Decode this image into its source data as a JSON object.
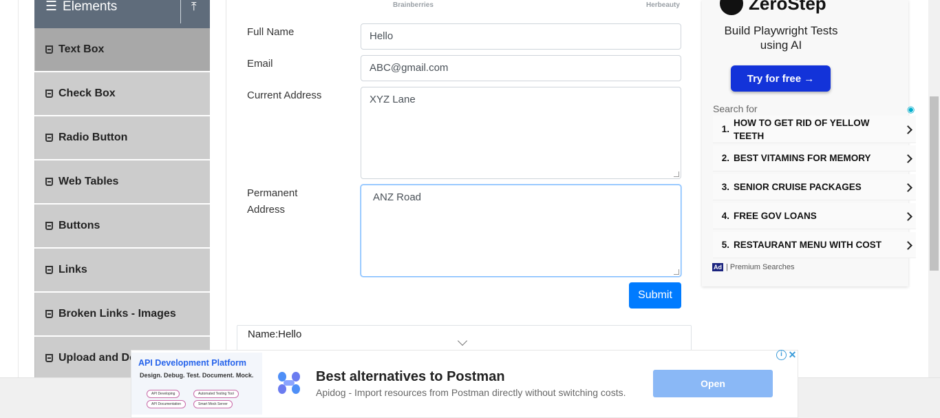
{
  "sidebar": {
    "header": {
      "title": "Elements",
      "collapse_icon": "upload-arrow-icon"
    },
    "items": [
      {
        "label": "Text Box",
        "active": true
      },
      {
        "label": "Check Box"
      },
      {
        "label": "Radio Button"
      },
      {
        "label": "Web Tables"
      },
      {
        "label": "Buttons"
      },
      {
        "label": "Links"
      },
      {
        "label": "Broken Links - Images"
      },
      {
        "label": "Upload and Download"
      }
    ]
  },
  "top_logos": [
    "Brainberries",
    "Herbeauty"
  ],
  "form": {
    "full_name": {
      "label": "Full Name",
      "value": "Hello"
    },
    "email": {
      "label": "Email",
      "value": "ABC@gmail.com"
    },
    "current_address": {
      "label": "Current Address",
      "value": "XYZ Lane"
    },
    "permanent_address": {
      "label": "Permanent Address",
      "value": "ANZ Road"
    },
    "submit_label": "Submit"
  },
  "output": {
    "name_line": "Name:Hello"
  },
  "right_ad": {
    "brand": "ZeroStep",
    "headline": "Build Playwright Tests using AI",
    "cta": "Try for free →",
    "search_for": "Search for",
    "results": [
      {
        "num": "1.",
        "text": "HOW TO GET RID OF YELLOW TEETH"
      },
      {
        "num": "2.",
        "text": "BEST VITAMINS FOR MEMORY"
      },
      {
        "num": "3.",
        "text": "SENIOR CRUISE PACKAGES"
      },
      {
        "num": "4.",
        "text": "FREE GOV LOANS"
      },
      {
        "num": "5.",
        "text": "RESTAURANT MENU WITH COST"
      }
    ],
    "ad_tag": "Ad",
    "footer": "| Premium Searches"
  },
  "bottom_ad": {
    "thumb_title": "API Development Platform",
    "thumb_sub": "Design. Debug. Test. Document. Mock.",
    "pills": [
      "API Developing",
      "Automated Testing Tool",
      "API Documentation",
      "Smart Mock Server"
    ],
    "title": "Best alternatives to Postman",
    "desc": "Apidog - Import resources from Postman directly without switching costs.",
    "open_label": "Open",
    "info_glyph": "i",
    "close_glyph": "✕"
  },
  "colors": {
    "primary": "#007bff",
    "sidebar_header": "#5f6c7b",
    "menu_bg": "#cccccc",
    "menu_active": "#a8a8a8",
    "cta_blue": "#1333d9"
  }
}
